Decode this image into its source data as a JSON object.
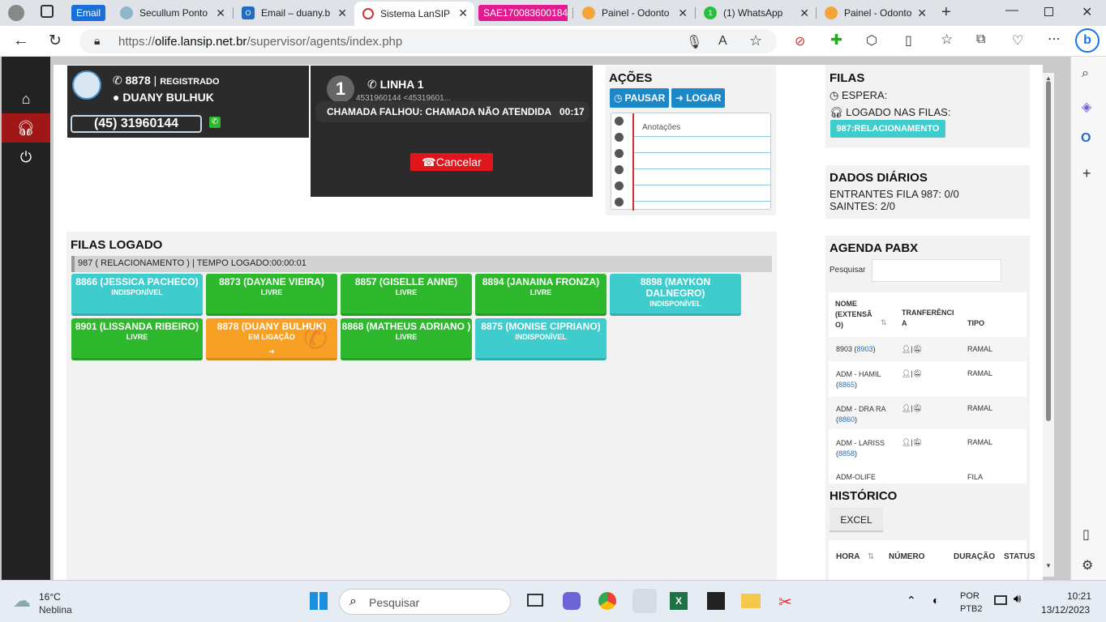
{
  "tabs": [
    {
      "label": "Email",
      "icon": "email-icon"
    },
    {
      "label": "Secullum Ponto",
      "icon": "secullum-icon"
    },
    {
      "label": "Email – duany.b",
      "icon": "outlook-icon"
    },
    {
      "label": "Sistema LanSIP",
      "icon": "lansip-icon"
    },
    {
      "label": "SAE170083600184",
      "icon": ""
    },
    {
      "label": "Painel - Odonto",
      "icon": "odonto-icon"
    },
    {
      "label": "(1) WhatsApp",
      "icon": "whatsapp-icon"
    },
    {
      "label": "Painel - Odonto",
      "icon": "odonto-icon"
    }
  ],
  "address": {
    "prefix": "https://",
    "host": "olife.lansip.net.br",
    "path": "/supervisor/agents/index.php"
  },
  "extension": {
    "number": "8878",
    "status": "REGISTRADO",
    "user": "DUANY BULHUK",
    "phone": "(45) 31960144"
  },
  "line": {
    "index": "1",
    "label": "LINHA 1",
    "caller": "4531960144 <45319601...",
    "message": "CHAMADA FALHOU: CHAMADA NÃO ATENDIDA",
    "timer": "00:17",
    "cancel": "Cancelar"
  },
  "actions": {
    "title": "AÇÕES",
    "pause": "PAUSAR",
    "login": "LOGAR",
    "notes_title": "Anotações"
  },
  "queues": {
    "title": "FILAS",
    "wait_label": "ESPERA:",
    "logged_label": "LOGADO NAS FILAS:",
    "queue_tag": "987:RELACIONAMENTO"
  },
  "daily": {
    "title": "DADOS DIÁRIOS",
    "incoming": "ENTRANTES FILA 987: 0/0",
    "outgoing": "SAINTES: 2/0"
  },
  "logged": {
    "title": "FILAS LOGADO",
    "info": "987 ( RELACIONAMENTO ) | TEMPO LOGADO:00:00:01"
  },
  "agents": [
    {
      "name": "8866 (JESSICA PACHECO)",
      "status": "INDISPONÍVEL",
      "color": "cyan"
    },
    {
      "name": "8873 (DAYANE VIEIRA)",
      "status": "LIVRE",
      "color": "green"
    },
    {
      "name": "8857 (GISELLE ANNE)",
      "status": "LIVRE",
      "color": "green"
    },
    {
      "name": "8894 (JANAINA FRONZA)",
      "status": "LIVRE",
      "color": "green"
    },
    {
      "name": "8898 (MAYKON DALNEGRO)",
      "status": "INDISPONÍVEL",
      "color": "cyan"
    },
    {
      "name": "8901 (LISSANDA RIBEIRO)",
      "status": "LIVRE",
      "color": "green"
    },
    {
      "name": "8878 (DUANY BULHUK)",
      "status": "EM LIGAÇÃO",
      "color": "orange"
    },
    {
      "name": "8868 (MATHEUS ADRIANO )",
      "status": "LIVRE",
      "color": "green"
    },
    {
      "name": "8875 (MONISE CIPRIANO)",
      "status": "INDISPONÍVEL",
      "color": "cyan"
    }
  ],
  "agenda": {
    "title": "AGENDA PABX",
    "search_label": "Pesquisar",
    "col_name": "NOME (EXTENSÃ O)",
    "col_transfer": "TRANFERÊNCI A",
    "col_type": "TIPO",
    "rows": [
      {
        "name": "8903 (",
        "ext": "8903",
        "close": ")",
        "type": "RAMAL"
      },
      {
        "name": "ADM - HAMIL (",
        "ext": "8865",
        "close": ")",
        "type": "RAMAL"
      },
      {
        "name": "ADM - DRA RA (",
        "ext": "8860",
        "close": ")",
        "type": "RAMAL"
      },
      {
        "name": "ADM - LARISS (",
        "ext": "8858",
        "close": ")",
        "type": "RAMAL"
      },
      {
        "name": "ADM-OLIFE",
        "ext": "",
        "close": "",
        "type": "FILA"
      }
    ]
  },
  "history": {
    "title": "HISTÓRICO",
    "excel": "EXCEL",
    "col_hora": "HORA",
    "col_numero": "NÚMERO",
    "col_duracao": "DURAÇÃO",
    "col_status": "STATUS"
  },
  "taskbar": {
    "temp": "16°C",
    "weather": "Neblina",
    "search": "Pesquisar",
    "lang1": "POR",
    "lang2": "PTB2",
    "time": "10:21",
    "date": "13/12/2023"
  },
  "colors": {
    "green": "#2db82d",
    "cyan": "#3fcccc",
    "orange": "#f7a023",
    "blue": "#1d88c8",
    "red": "#e0161c"
  }
}
